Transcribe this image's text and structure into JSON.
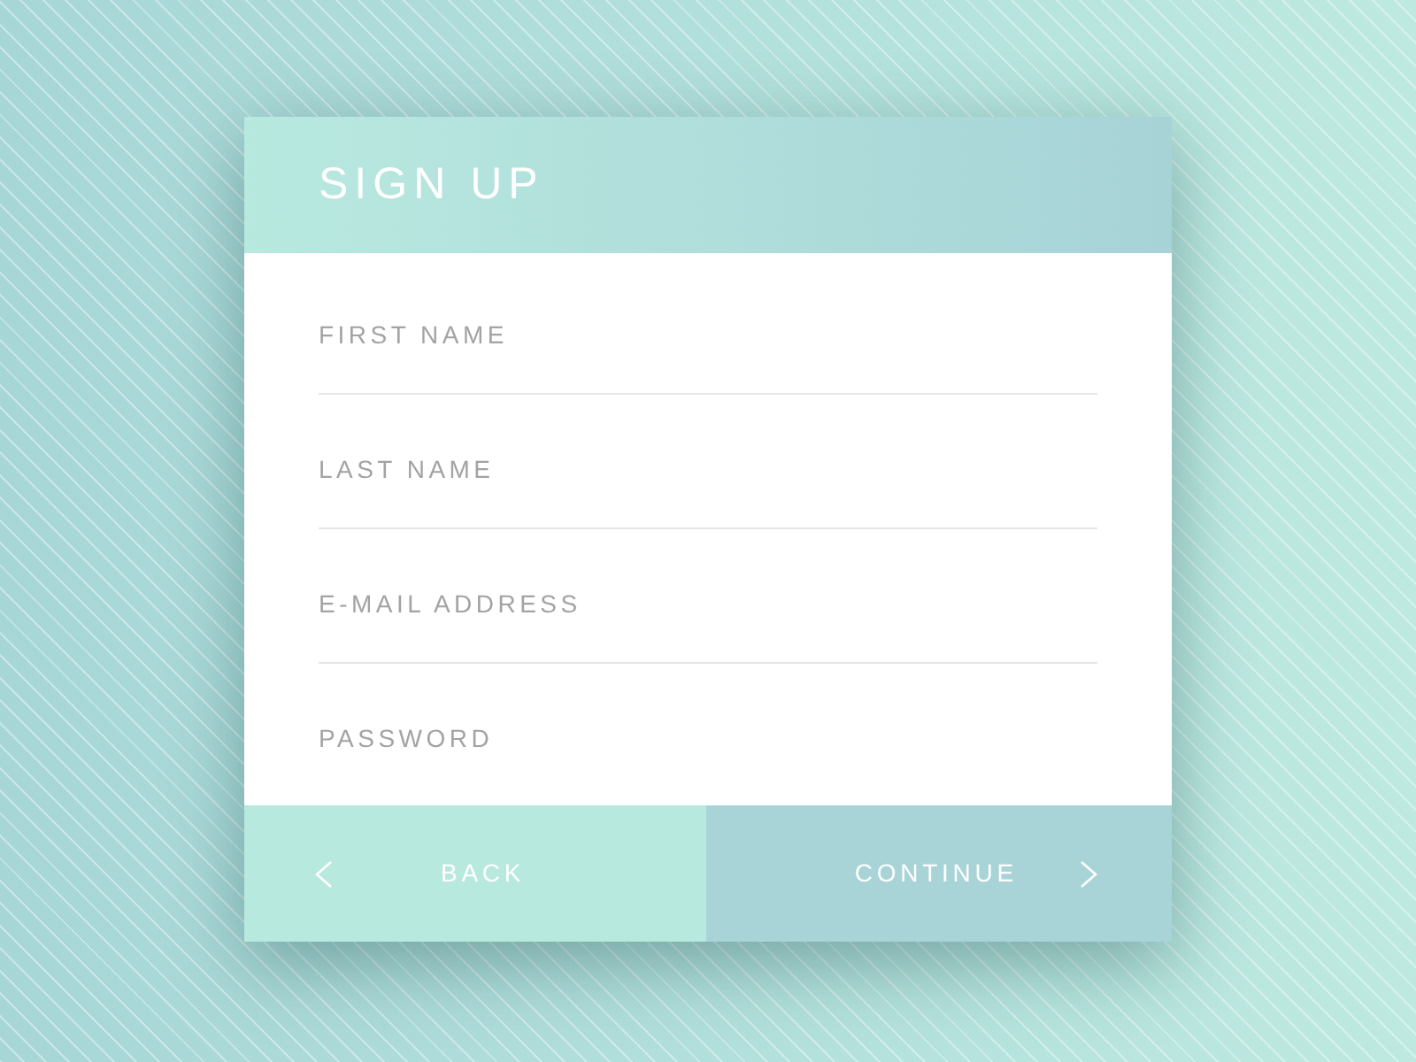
{
  "header": {
    "title": "SIGN UP"
  },
  "fields": [
    {
      "placeholder": "FIRST NAME"
    },
    {
      "placeholder": "LAST NAME"
    },
    {
      "placeholder": "E-MAIL ADDRESS"
    },
    {
      "placeholder": "PASSWORD"
    }
  ],
  "buttons": [
    {
      "kind": "back",
      "label": "BACK"
    },
    {
      "kind": "continue",
      "label": "CONTINUE"
    }
  ]
}
